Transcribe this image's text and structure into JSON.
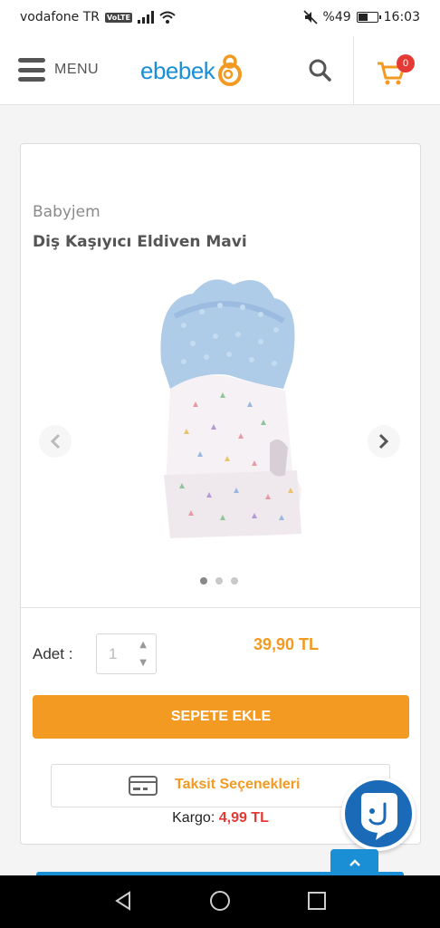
{
  "status_bar": {
    "carrier": "vodafone TR",
    "volte": "VoLTE",
    "battery": "%49",
    "time": "16:03"
  },
  "header": {
    "menu_label": "MENU",
    "logo_text": "ebebek",
    "cart_count": "0"
  },
  "product": {
    "brand": "Babyjem",
    "title": "Diş Kaşıyıcı Eldiven Mavi",
    "image_dots": 3,
    "active_dot": 0
  },
  "purchase": {
    "qty_label": "Adet :",
    "qty_value": "1",
    "price": "39,90 TL",
    "add_to_cart": "SEPETE EKLE",
    "installment": "Taksit Seçenekleri",
    "cargo_label": "Kargo:",
    "cargo_value": "4,99 TL"
  },
  "colors": {
    "accent_orange": "#f39a23",
    "brand_blue": "#1a8fd6",
    "price_red": "#e53935"
  }
}
